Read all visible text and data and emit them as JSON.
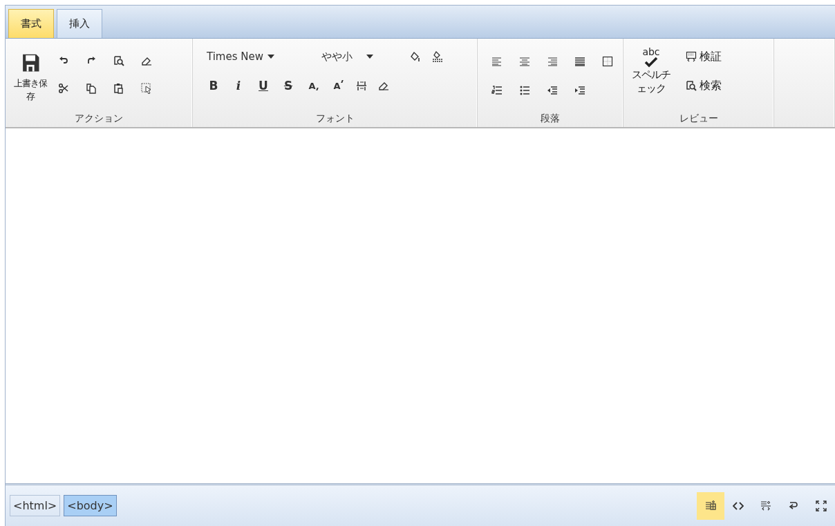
{
  "tabs": [
    {
      "label": "書式",
      "selected": true
    },
    {
      "label": "挿入",
      "selected": false
    }
  ],
  "ribbon": {
    "action": {
      "title": "アクション",
      "save_label": "上書き保存"
    },
    "font": {
      "title": "フォント",
      "font_name": "Times New",
      "font_size": "やや小",
      "format_buttons": [
        {
          "kind": "bold",
          "label": "B"
        },
        {
          "kind": "italic",
          "label": "i"
        },
        {
          "kind": "underline",
          "label": "U"
        },
        {
          "kind": "strike",
          "label": "S"
        },
        {
          "kind": "subscript",
          "label": "A"
        },
        {
          "kind": "superscript",
          "label": "A"
        }
      ]
    },
    "paragraph": {
      "title": "段落"
    },
    "review": {
      "title": "レビュー",
      "spell_icon_text": "abc",
      "spell_label": "スペルチェック",
      "validate_label": "検証",
      "find_label": "検索"
    }
  },
  "tag_path": [
    {
      "label": "<html>",
      "selected": false
    },
    {
      "label": "<body>",
      "selected": true
    }
  ],
  "view_modes": [
    {
      "selected": true
    },
    {
      "selected": false
    },
    {
      "selected": false
    },
    {
      "selected": false
    },
    {
      "selected": false
    }
  ]
}
